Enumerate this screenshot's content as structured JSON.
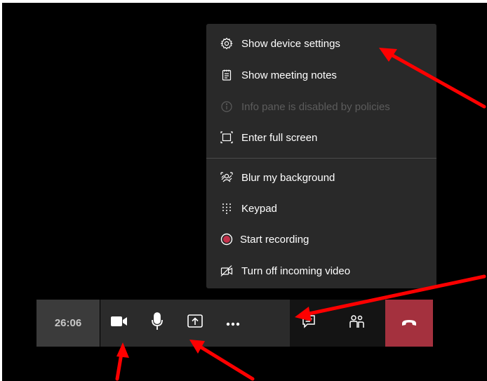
{
  "menu": {
    "items": [
      {
        "label": "Show device settings",
        "icon": "gear-icon",
        "enabled": true
      },
      {
        "label": "Show meeting notes",
        "icon": "notes-icon",
        "enabled": true
      },
      {
        "label": "Info pane is disabled by policies",
        "icon": "info-icon",
        "enabled": false
      },
      {
        "label": "Enter full screen",
        "icon": "fullscreen-icon",
        "enabled": true
      },
      {
        "label": "Blur my background",
        "icon": "blur-background-icon",
        "enabled": true
      },
      {
        "label": "Keypad",
        "icon": "keypad-icon",
        "enabled": true
      },
      {
        "label": "Start recording",
        "icon": "record-icon",
        "enabled": true
      },
      {
        "label": "Turn off incoming video",
        "icon": "video-off-icon",
        "enabled": true
      }
    ]
  },
  "callbar": {
    "timer": "26:06",
    "buttons": [
      "camera-icon",
      "microphone-icon",
      "share-screen-icon",
      "more-options-icon",
      "chat-icon",
      "participants-icon",
      "hang-up-icon"
    ]
  },
  "colors": {
    "background": "#000000",
    "menu_bg": "#292929",
    "bar_bg": "#2b2b2b",
    "hangup": "#a4313e",
    "record": "#c4314b",
    "annotation_arrow": "#ff0000"
  }
}
